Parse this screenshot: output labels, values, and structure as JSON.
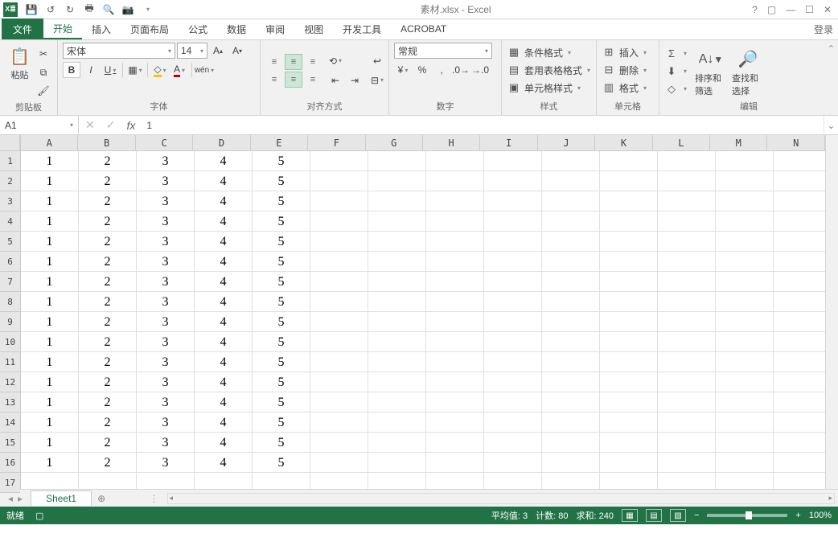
{
  "title": "素材.xlsx - Excel",
  "tabs": {
    "file": "文件",
    "items": [
      "开始",
      "插入",
      "页面布局",
      "公式",
      "数据",
      "审阅",
      "视图",
      "开发工具",
      "ACROBAT"
    ],
    "active": 0,
    "login": "登录"
  },
  "ribbon": {
    "clipboard": {
      "paste": "粘贴",
      "label": "剪贴板"
    },
    "font": {
      "name": "宋体",
      "size": "14",
      "bold": "B",
      "italic": "I",
      "underline": "U",
      "phonetic": "wén",
      "label": "字体"
    },
    "align": {
      "label": "对齐方式"
    },
    "number": {
      "format": "常规",
      "percent": "%",
      "comma": ",",
      "label": "数字"
    },
    "styles": {
      "cond": "条件格式",
      "table": "套用表格格式",
      "cell": "单元格样式",
      "label": "样式"
    },
    "cells": {
      "insert": "插入",
      "delete": "删除",
      "format": "格式",
      "label": "单元格"
    },
    "editing": {
      "sum": "Σ",
      "sort": "排序和筛选",
      "find": "查找和选择",
      "label": "编辑"
    }
  },
  "namebox": "A1",
  "formula": "1",
  "columns": [
    "A",
    "B",
    "C",
    "D",
    "E",
    "F",
    "G",
    "H",
    "I",
    "J",
    "K",
    "L",
    "M",
    "N"
  ],
  "rows": 17,
  "data_rows": 16,
  "row_values": [
    "1",
    "2",
    "3",
    "4",
    "5"
  ],
  "sheet": {
    "name": "Sheet1"
  },
  "status": {
    "ready": "就绪",
    "avg": "平均值: 3",
    "count": "计数: 80",
    "sum": "求和: 240",
    "zoom": "100%"
  }
}
